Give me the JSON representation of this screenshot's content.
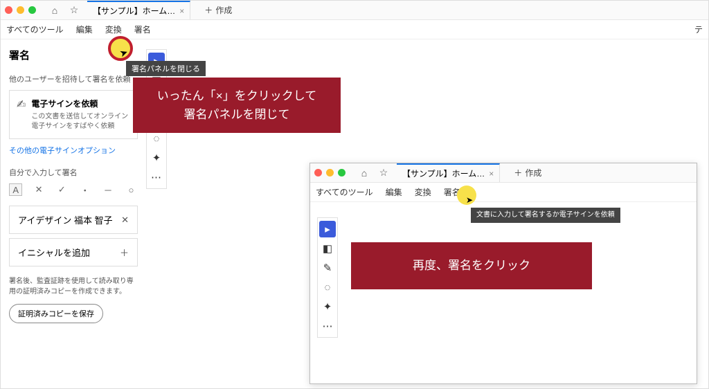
{
  "main": {
    "tab_title": "【サンプル】ホーム…",
    "tab_close": "×",
    "new_tab": "作成",
    "home_icon": "⌂",
    "star_icon": "☆",
    "plus": "＋",
    "menubar": [
      "すべてのツール",
      "編集",
      "変換",
      "署名"
    ],
    "menubar_right": "テ"
  },
  "panel": {
    "title": "署名",
    "invite_header": "他のユーザーを招待して署名を依頼",
    "esign_box": {
      "title": "電子サインを依頼",
      "desc": "この文書を送信してオンライン電子サインをすばやく依頼"
    },
    "other_link": "その他の電子サインオプション",
    "self_header": "自分で入力して署名",
    "signature_name": "アイデザイン 福本 智子",
    "remove": "✕",
    "add_initials": "イニシャルを追加",
    "add_plus": "＋",
    "note": "署名後、監査証跡を使用して読み取り専用の証明済みコピーを作成できます。",
    "save_button": "証明済みコピーを保存"
  },
  "shapes": [
    "A",
    "✕",
    "✓",
    "・",
    "─",
    "○"
  ],
  "highlight": {
    "tooltip": "署名パネルを閉じる",
    "callout1": "いったん「×」をクリックして\n署名パネルを閉じて",
    "callout2": "再度、署名をクリック"
  },
  "inset": {
    "tab_title": "【サンプル】ホーム…",
    "tooltip": "文書に入力して署名するか電子サインを依頼"
  },
  "toolbar_icons": [
    "▸",
    "◧",
    "T",
    "✎",
    "◌",
    "✦",
    "⋯"
  ],
  "toolbar2_icons": [
    "▸",
    "◧",
    "✎",
    "◌",
    "✦",
    "⋯"
  ],
  "blur_lines": "　　　　　　　　　　　　　　　　　　　　　　　　　　　　　　　　　　\n　　　　　　　　　　　　　　　　　　　　　　　　　　　　\n　　　　　　　　　　　　　　　　　　\n　　　　　　　　　　　\n　　　　　　　　　　　　　　　　　　　　　　　　　　　　　　　　　　　　　　　　　　　　\n　　　　　　　　　　　　　　　　　　　　　　　　　　　　　　　　　　　　　　　　　　　　　　\n　　　　　　　　　　　　　　　　　　　　　\n　　　　　　　　　\n　　　　　　　　　　　　　　　　　　　　　　　　　　　　　　　　　　　　　　　　　　　　　　\n　　　　　　　　　　　　　　　　　　　　　　　　　　　　　　　　　　　　　　　　　　　　　　"
}
